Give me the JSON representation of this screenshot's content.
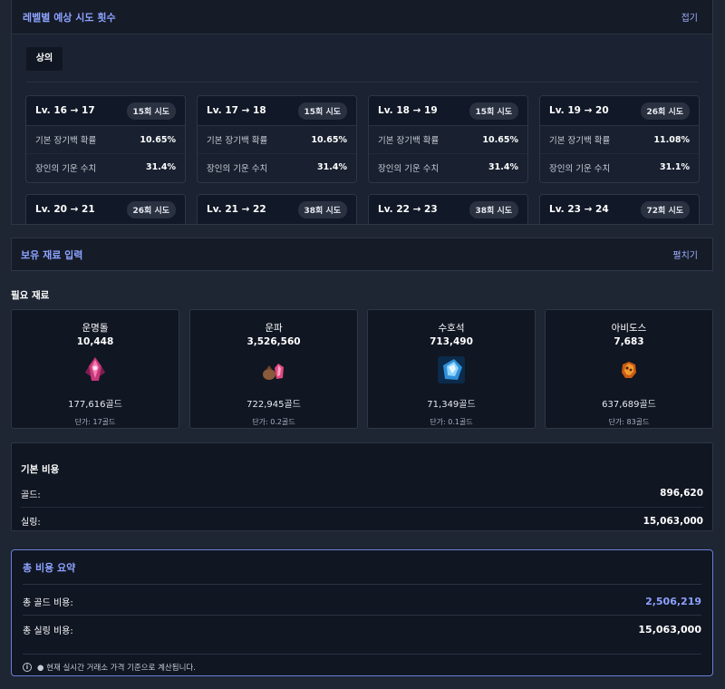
{
  "attempts_panel": {
    "title": "레벨별 예상 시도 횟수",
    "toggle": "접기",
    "tab": "상의",
    "levels": [
      {
        "label": "Lv. 16 → 17",
        "attempts": "15회 시도",
        "base_rate_label": "기본 장기백 확률",
        "base_rate": "10.65%",
        "artisan_label": "장인의 기운 수치",
        "artisan": "31.4%"
      },
      {
        "label": "Lv. 17 → 18",
        "attempts": "15회 시도",
        "base_rate_label": "기본 장기백 확률",
        "base_rate": "10.65%",
        "artisan_label": "장인의 기운 수치",
        "artisan": "31.4%"
      },
      {
        "label": "Lv. 18 → 19",
        "attempts": "15회 시도",
        "base_rate_label": "기본 장기백 확률",
        "base_rate": "10.65%",
        "artisan_label": "장인의 기운 수치",
        "artisan": "31.4%"
      },
      {
        "label": "Lv. 19 → 20",
        "attempts": "26회 시도",
        "base_rate_label": "기본 장기백 확률",
        "base_rate": "11.08%",
        "artisan_label": "장인의 기운 수치",
        "artisan": "31.1%"
      },
      {
        "label": "Lv. 20 → 21",
        "attempts": "26회 시도"
      },
      {
        "label": "Lv. 21 → 22",
        "attempts": "38회 시도"
      },
      {
        "label": "Lv. 22 → 23",
        "attempts": "38회 시도"
      },
      {
        "label": "Lv. 23 → 24",
        "attempts": "72회 시도"
      }
    ]
  },
  "owned_panel": {
    "title": "보유 재료 입력",
    "toggle": "펼치기"
  },
  "materials": {
    "label": "필요 재료",
    "items": [
      {
        "name": "운명돌",
        "qty": "10,448",
        "gold": "177,616골드",
        "unit": "단가: 17골드",
        "icon": "destiny-stone-icon"
      },
      {
        "name": "운파",
        "qty": "3,526,560",
        "gold": "722,945골드",
        "unit": "단가: 0.2골드",
        "icon": "destiny-shard-icon"
      },
      {
        "name": "수호석",
        "qty": "713,490",
        "gold": "71,349골드",
        "unit": "단가: 0.1골드",
        "icon": "guardian-stone-icon"
      },
      {
        "name": "아비도스",
        "qty": "7,683",
        "gold": "637,689골드",
        "unit": "단가: 83골드",
        "icon": "abidos-icon"
      }
    ]
  },
  "base_cost": {
    "title": "기본 비용",
    "gold_label": "골드:",
    "gold": "896,620",
    "silver_label": "실링:",
    "silver": "15,063,000"
  },
  "summary": {
    "title": "총 비용 요약",
    "gold_label": "총 골드 비용:",
    "gold": "2,506,219",
    "silver_label": "총 실링 비용:",
    "silver": "15,063,000",
    "note": "● 현재 실시간 거래소 가격 기준으로 계산됩니다.",
    "accent_color": "#8da2ff"
  }
}
